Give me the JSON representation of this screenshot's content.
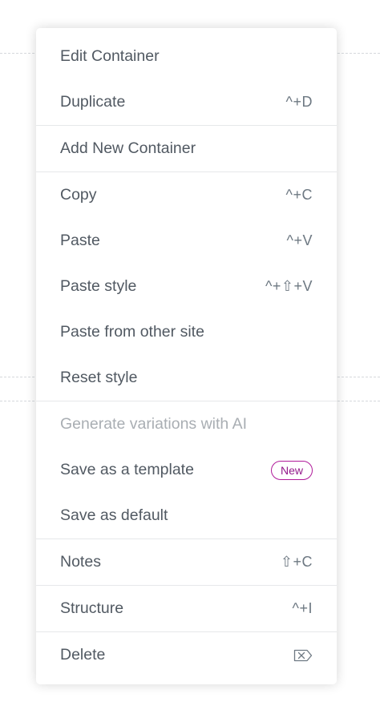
{
  "menu": {
    "groups": [
      {
        "items": [
          {
            "label": "Edit Container",
            "shortcut": ""
          },
          {
            "label": "Duplicate",
            "shortcut": "^+D"
          }
        ]
      },
      {
        "items": [
          {
            "label": "Add New Container",
            "shortcut": ""
          }
        ]
      },
      {
        "items": [
          {
            "label": "Copy",
            "shortcut": "^+C"
          },
          {
            "label": "Paste",
            "shortcut": "^+V"
          },
          {
            "label": "Paste style",
            "shortcut": "^+⇧+V"
          },
          {
            "label": "Paste from other site",
            "shortcut": ""
          },
          {
            "label": "Reset style",
            "shortcut": ""
          }
        ]
      },
      {
        "items": [
          {
            "label": "Generate variations with AI",
            "shortcut": "",
            "disabled": true
          },
          {
            "label": "Save as a template",
            "badge": "New"
          },
          {
            "label": "Save as default",
            "shortcut": ""
          }
        ]
      },
      {
        "items": [
          {
            "label": "Notes",
            "shortcut": "⇧+C"
          }
        ]
      },
      {
        "items": [
          {
            "label": "Structure",
            "shortcut": "^+I"
          }
        ]
      },
      {
        "items": [
          {
            "label": "Delete",
            "icon": "delete-key-icon"
          }
        ]
      }
    ]
  },
  "colors": {
    "text": "#515962",
    "shortcut": "#6d7882",
    "disabled": "#a9aeb3",
    "badge_border": "#b01b9a",
    "divider": "#e6e8ea"
  }
}
